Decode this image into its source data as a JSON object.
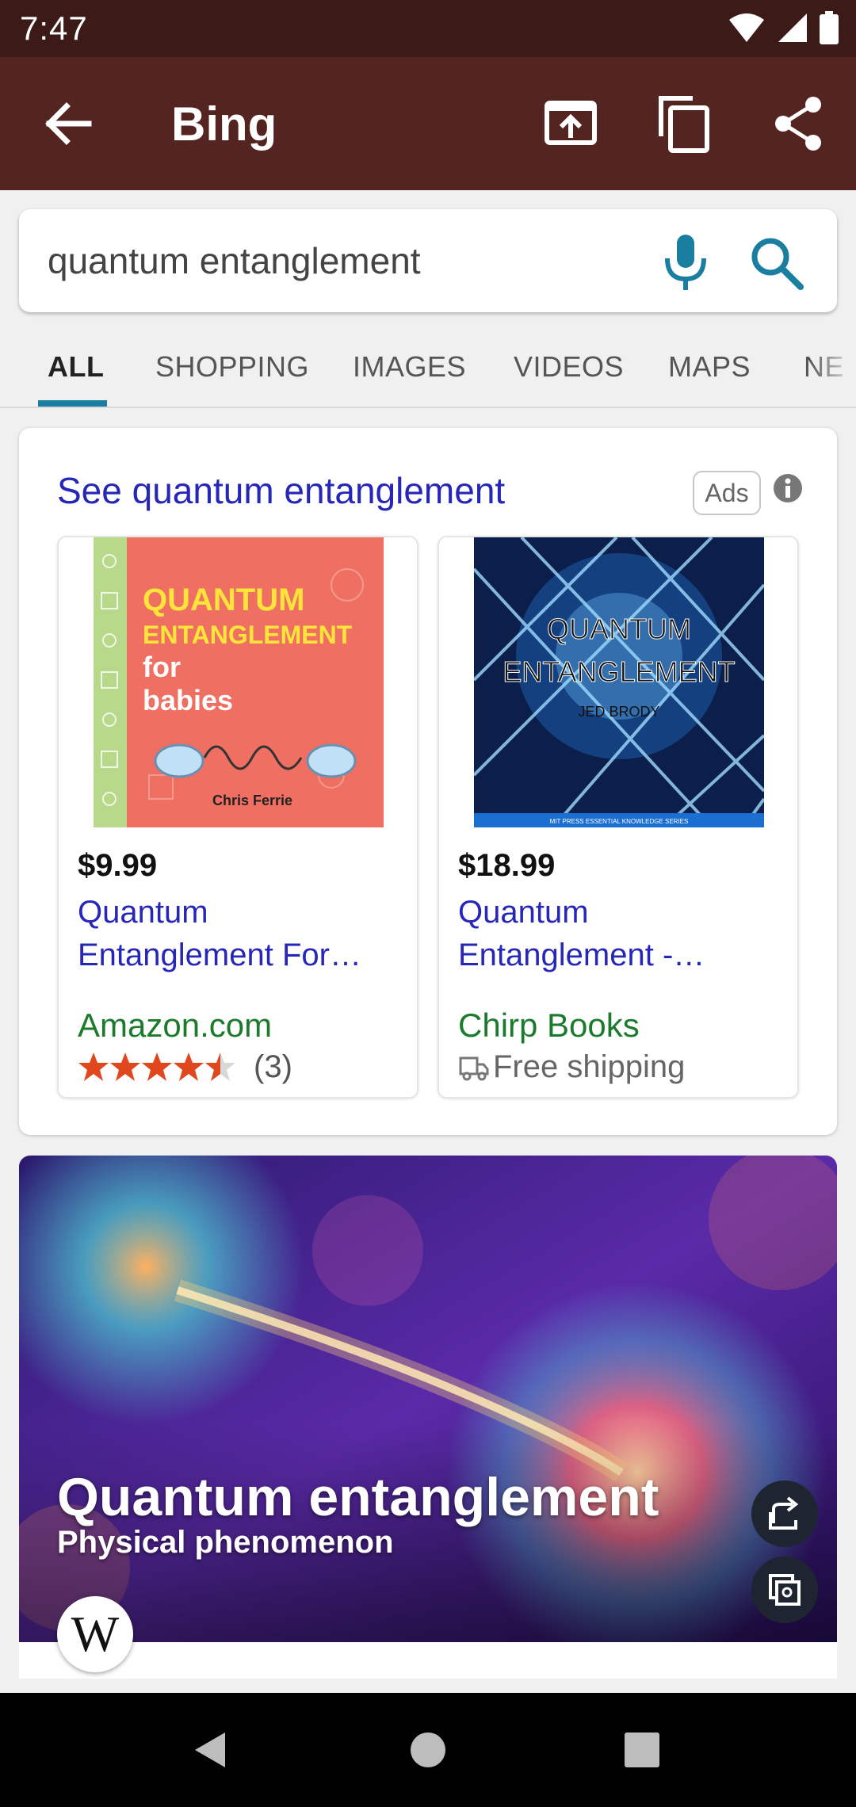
{
  "status_bar": {
    "time": "7:47"
  },
  "app_bar": {
    "title": "Bing"
  },
  "search": {
    "query": "quantum entanglement"
  },
  "tabs": [
    {
      "label": "ALL"
    },
    {
      "label": "SHOPPING"
    },
    {
      "label": "IMAGES"
    },
    {
      "label": "VIDEOS"
    },
    {
      "label": "MAPS"
    },
    {
      "label": "NE"
    }
  ],
  "ads": {
    "title": "See quantum entanglement",
    "badge": "Ads",
    "products": [
      {
        "price": "$9.99",
        "title": "Quantum Entanglement For…",
        "seller": "Amazon.com",
        "rating_count": "(3)",
        "rating": 4.5,
        "cover": {
          "line1": "QUANTUM",
          "line2": "ENTANGLEMENT",
          "line3": "for",
          "line4": "babies",
          "author": "Chris Ferrie"
        }
      },
      {
        "price": "$18.99",
        "title": "Quantum Entanglement -…",
        "seller": "Chirp Books",
        "shipping": "Free shipping",
        "cover": {
          "line1": "QUANTUM",
          "line2": "ENTANGLEMENT",
          "author": "JED BRODY",
          "series": "MIT PRESS ESSENTIAL KNOWLEDGE SERIES"
        }
      }
    ]
  },
  "wiki": {
    "title": "Quantum entanglement",
    "subtitle": "Physical phenomenon",
    "logo": "W"
  },
  "colors": {
    "status_bar": "#3b1a17",
    "app_bar": "#542420",
    "link": "#2626b8",
    "seller": "#1b7a2b",
    "accent": "#1a7ea0",
    "star": "#e0471c"
  }
}
